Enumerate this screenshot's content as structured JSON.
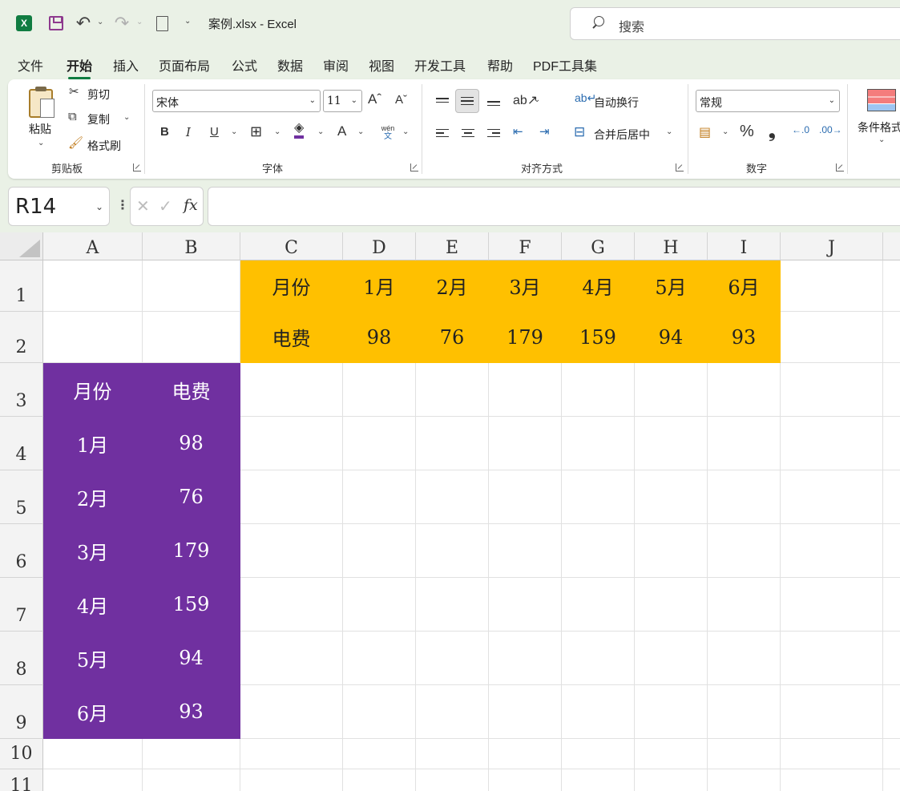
{
  "app": {
    "window_title": "案例.xlsx  -  Excel",
    "search_placeholder": "搜索"
  },
  "menu_tabs": [
    "文件",
    "开始",
    "插入",
    "页面布局",
    "公式",
    "数据",
    "审阅",
    "视图",
    "开发工具",
    "帮助",
    "PDF工具集"
  ],
  "active_tab": "开始",
  "ribbon": {
    "clipboard": {
      "label": "剪贴板",
      "paste": "粘贴",
      "cut": "剪切",
      "copy": "复制",
      "format_painter": "格式刷"
    },
    "font": {
      "label": "字体",
      "font_name": "宋体",
      "font_size": "11",
      "bold": "B",
      "italic": "I",
      "underline": "U",
      "phonetic_top": "wén",
      "phonetic_bottom": "文"
    },
    "alignment": {
      "label": "对齐方式",
      "wrap_text": "自动换行",
      "merge_center": "合并后居中"
    },
    "number": {
      "label": "数字",
      "format": "常规",
      "percent": "%",
      "comma": "❟"
    },
    "styles": {
      "conditional": "条件格式"
    }
  },
  "formula_bar": {
    "name_box": "R14",
    "fx": "fx",
    "cancel": "✕",
    "enter": "✓",
    "content": ""
  },
  "columns": [
    "A",
    "B",
    "C",
    "D",
    "E",
    "F",
    "G",
    "H",
    "I",
    "J"
  ],
  "rows": [
    "1",
    "2",
    "3",
    "4",
    "5",
    "6",
    "7",
    "8",
    "9",
    "10",
    "11"
  ],
  "table_horizontal": {
    "header": [
      "月份",
      "1月",
      "2月",
      "3月",
      "4月",
      "5月",
      "6月"
    ],
    "values": [
      "电费",
      "98",
      "76",
      "179",
      "159",
      "94",
      "93"
    ]
  },
  "table_vertical": {
    "header": [
      "月份",
      "电费"
    ],
    "rows": [
      [
        "1月",
        "98"
      ],
      [
        "2月",
        "76"
      ],
      [
        "3月",
        "179"
      ],
      [
        "4月",
        "159"
      ],
      [
        "5月",
        "94"
      ],
      [
        "6月",
        "93"
      ]
    ]
  },
  "colors": {
    "accent": "#107c41",
    "yellow_fill": "#ffc000",
    "purple_fill": "#7030a0"
  }
}
